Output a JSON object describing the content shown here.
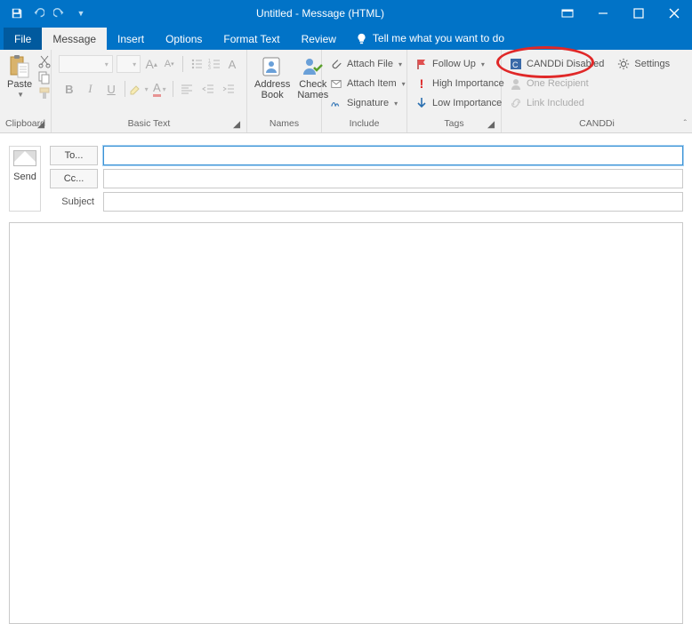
{
  "titlebar": {
    "title": "Untitled  -  Message (HTML)"
  },
  "tabs": {
    "file": "File",
    "items": [
      "Message",
      "Insert",
      "Options",
      "Format Text",
      "Review"
    ],
    "active": 0,
    "tellme": "Tell me what you want to do"
  },
  "ribbon": {
    "clipboard": {
      "paste": "Paste",
      "label": "Clipboard"
    },
    "basic_text": {
      "label": "Basic Text",
      "grow": "A",
      "shrink": "A",
      "bold": "B",
      "italic": "I",
      "underline": "U",
      "fontcolor": "A"
    },
    "names": {
      "address_book": "Address\nBook",
      "check_names": "Check\nNames",
      "label": "Names"
    },
    "include": {
      "attach_file": "Attach File",
      "attach_item": "Attach Item",
      "signature": "Signature",
      "label": "Include"
    },
    "tags": {
      "follow_up": "Follow Up",
      "high": "High Importance",
      "low": "Low Importance",
      "label": "Tags"
    },
    "canddi": {
      "disabled": "CANDDi Disabled",
      "settings": "Settings",
      "one_recipient": "One Recipient",
      "link_included": "Link Included",
      "label": "CANDDi"
    }
  },
  "compose": {
    "send": "Send",
    "to": "To...",
    "cc": "Cc...",
    "subject": "Subject"
  }
}
